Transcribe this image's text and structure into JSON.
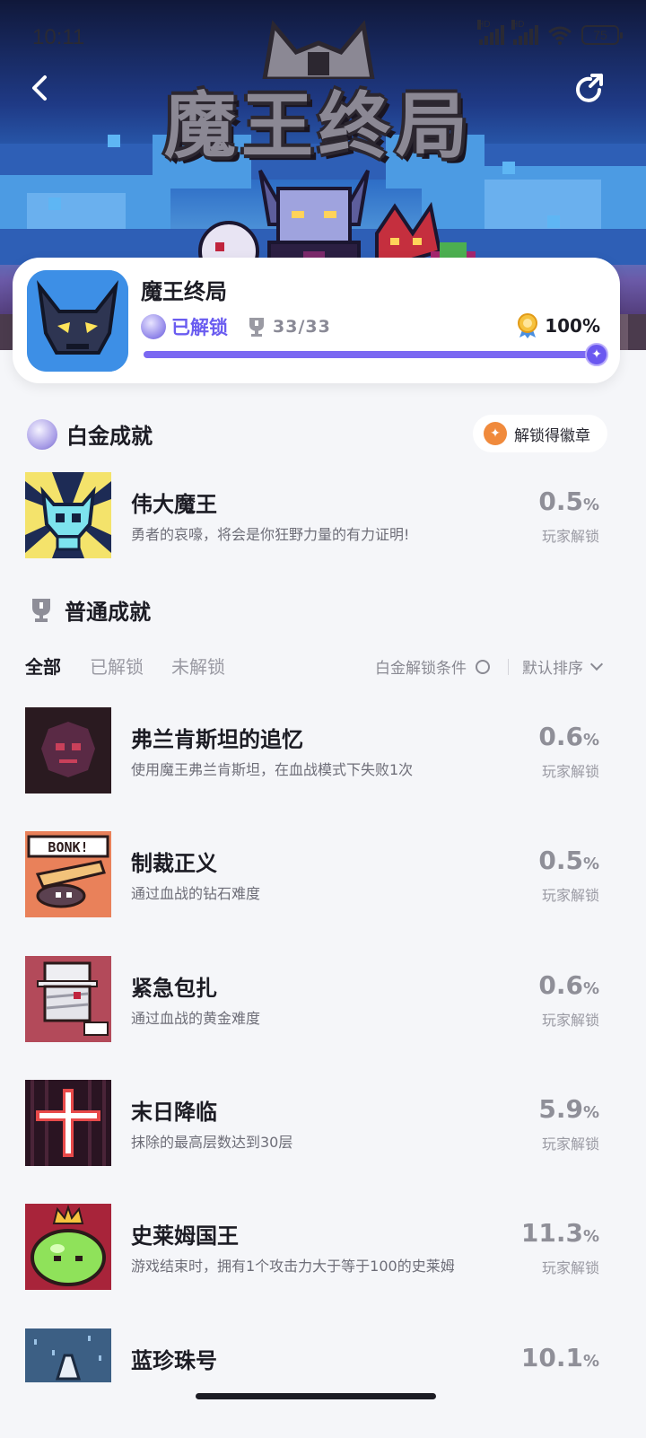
{
  "status_bar": {
    "time": "10:11",
    "battery": "75",
    "signal_label": "HD"
  },
  "hero": {
    "logo_text": "魔王终局"
  },
  "game": {
    "name": "魔王终局",
    "unlocked_label": "已解锁",
    "trophy_count": "33/33",
    "percent": "100%",
    "progress": 1.0
  },
  "platinum": {
    "title": "白金成就",
    "badge_button": "解锁得徽章",
    "item": {
      "title": "伟大魔王",
      "desc": "勇者的哀嚎，将会是你狂野力量的有力证明!",
      "pct": "0.5",
      "pct_unit": "%",
      "sub": "玩家解锁"
    }
  },
  "normal": {
    "title": "普通成就",
    "tabs": [
      "全部",
      "已解锁",
      "未解锁"
    ],
    "condition_label": "白金解锁条件",
    "sort_label": "默认排序",
    "items": [
      {
        "title": "弗兰肯斯坦的追忆",
        "desc": "使用魔王弗兰肯斯坦，在血战模式下失败1次",
        "pct": "0.6",
        "pct_unit": "%",
        "sub": "玩家解锁"
      },
      {
        "title": "制裁正义",
        "desc": "通过血战的钻石难度",
        "pct": "0.5",
        "pct_unit": "%",
        "sub": "玩家解锁",
        "thumb_text": "BONK!"
      },
      {
        "title": "紧急包扎",
        "desc": "通过血战的黄金难度",
        "pct": "0.6",
        "pct_unit": "%",
        "sub": "玩家解锁"
      },
      {
        "title": "末日降临",
        "desc": "抹除的最高层数达到30层",
        "pct": "5.9",
        "pct_unit": "%",
        "sub": "玩家解锁"
      },
      {
        "title": "史莱姆国王",
        "desc": "游戏结束时，拥有1个攻击力大于等于100的史莱姆",
        "pct": "11.3",
        "pct_unit": "%",
        "sub": "玩家解锁"
      },
      {
        "title": "蓝珍珠号",
        "desc": "",
        "pct": "10.1",
        "pct_unit": "%",
        "sub": ""
      }
    ]
  },
  "colors": {
    "accent": "#6a5cf0",
    "page_bg": "#f5f6f9",
    "card_bg": "#ffffff"
  }
}
